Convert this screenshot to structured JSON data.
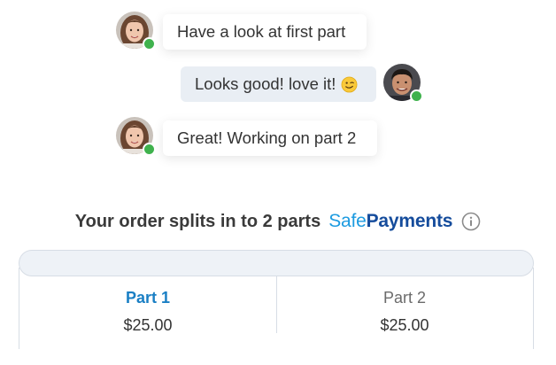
{
  "chat": {
    "messages": [
      {
        "sender": "other",
        "text": "Have a look at first part"
      },
      {
        "sender": "me",
        "text": "Looks good! love it!",
        "emoji": "winking-face-icon"
      },
      {
        "sender": "other",
        "text": "Great! Working on part 2"
      }
    ],
    "status_color": "#3fb24d",
    "outgoing_bubble_color": "#e9eef4"
  },
  "order_split": {
    "heading": "Your order splits in to 2 parts",
    "brand": {
      "part1": "Safe",
      "part2": "Payments",
      "color1": "#1d9be0",
      "color2": "#154c9c"
    },
    "info_icon": "info-icon",
    "parts": [
      {
        "label": "Part 1",
        "amount": "$25.00",
        "active": true
      },
      {
        "label": "Part 2",
        "amount": "$25.00",
        "active": false
      }
    ],
    "accent_color": "#1a7fc4"
  }
}
